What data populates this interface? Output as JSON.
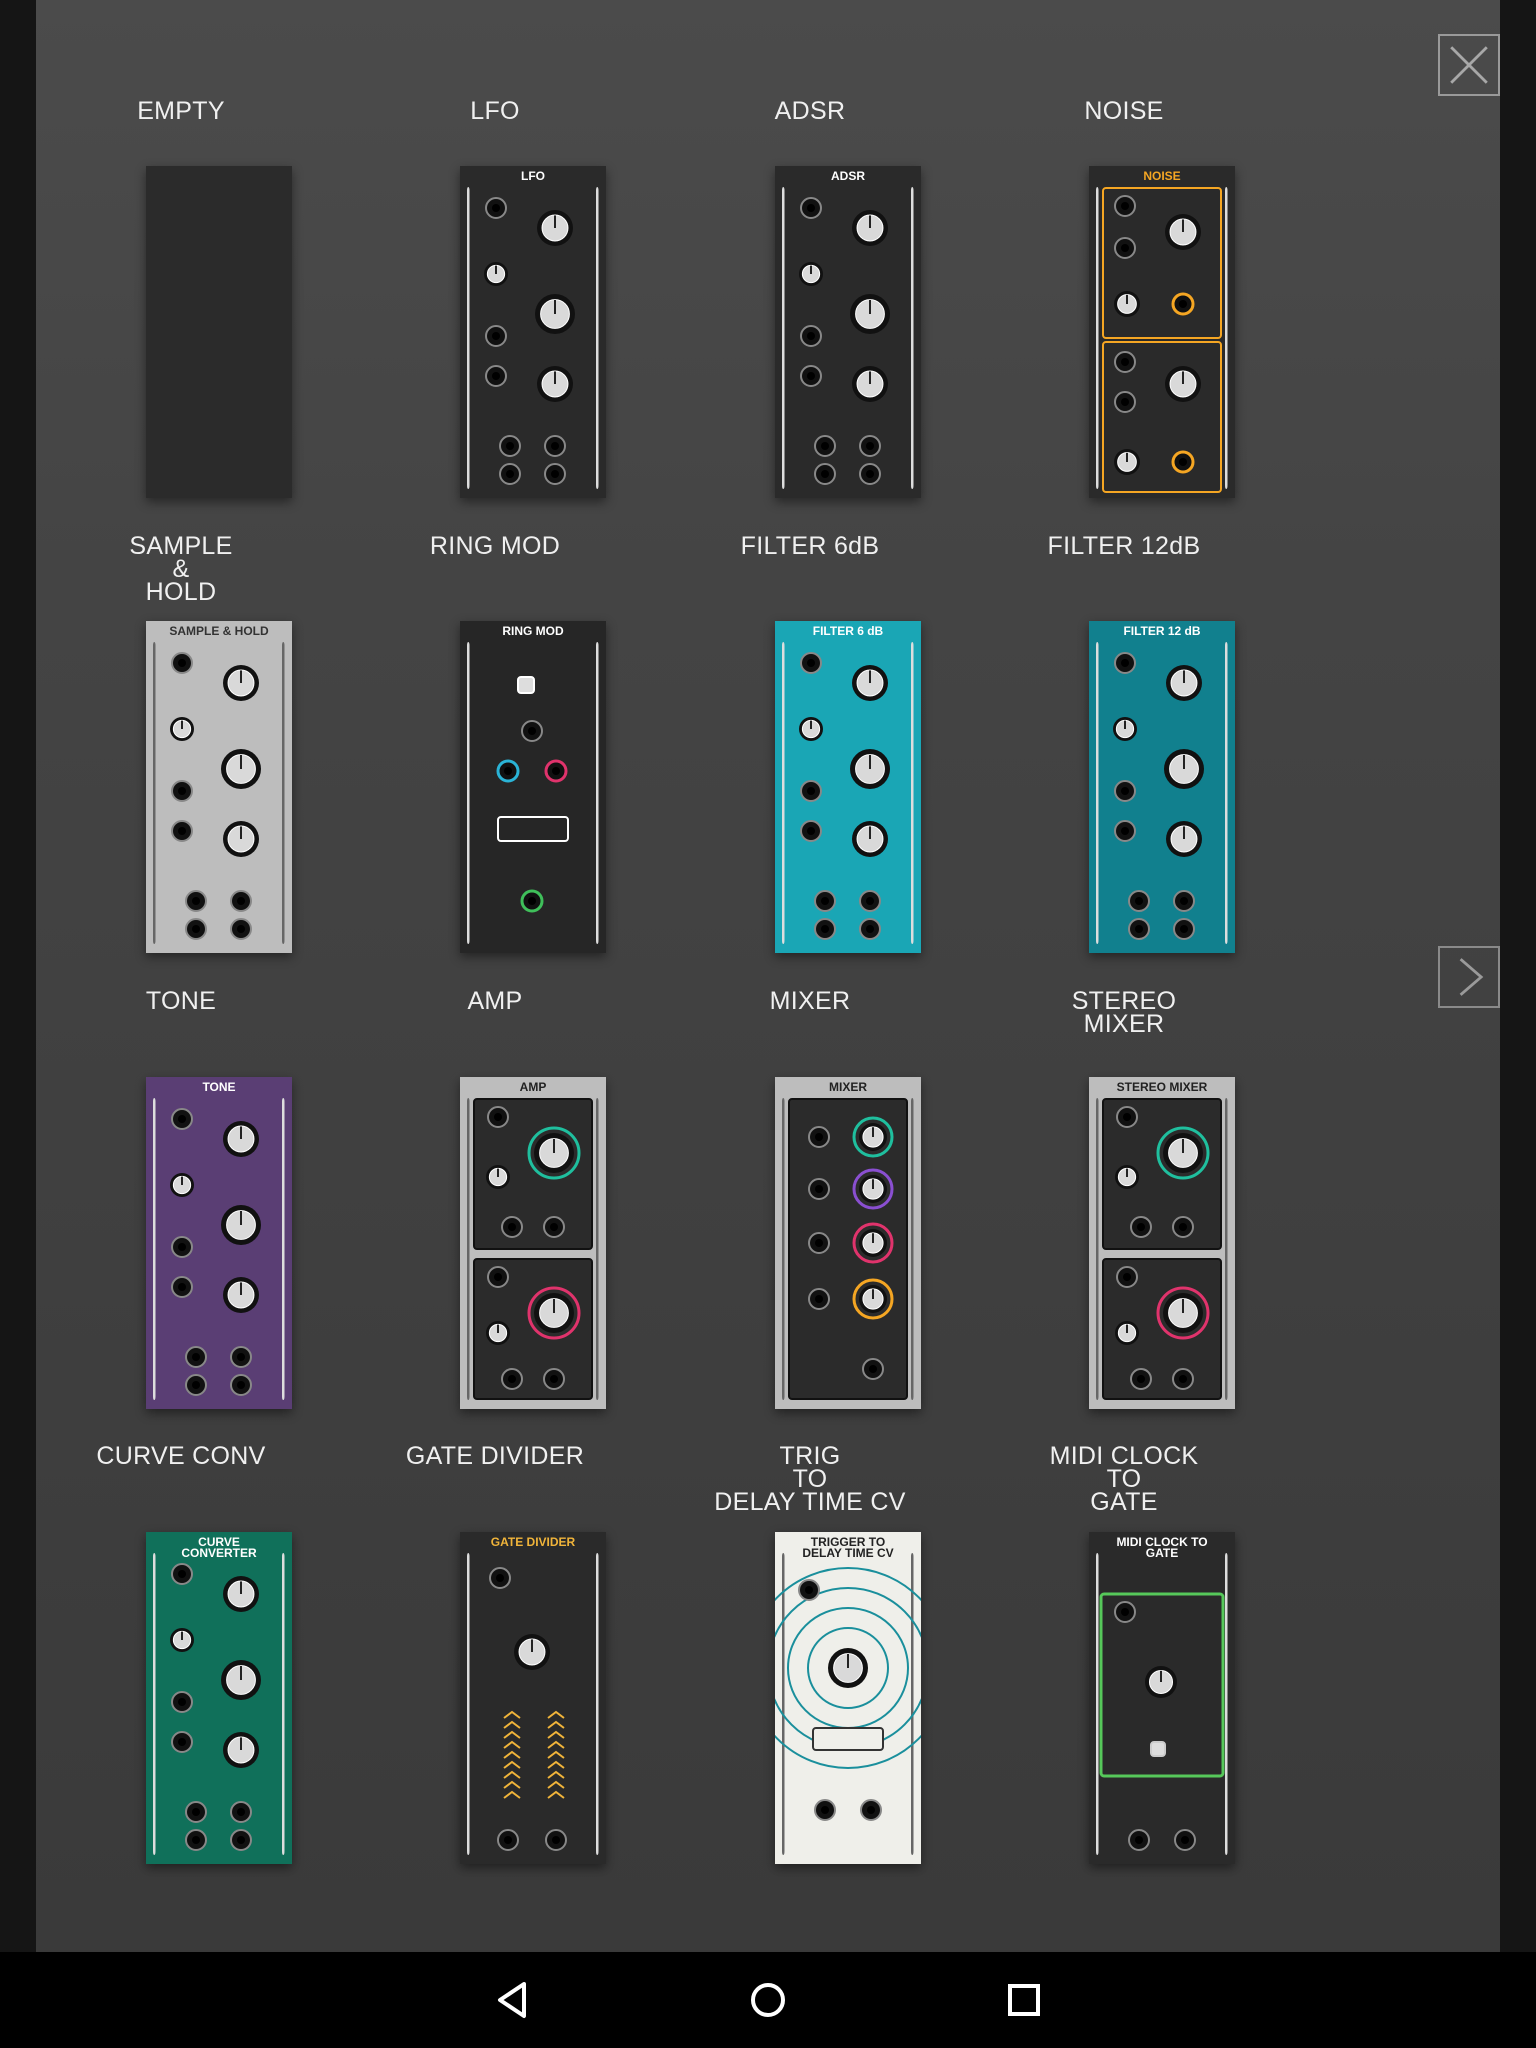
{
  "buttons": {
    "close_icon": "close-x-icon",
    "next_icon": "chevron-right-icon"
  },
  "modules": [
    {
      "id": "empty",
      "title": "EMPTY",
      "label": "",
      "bg": "#2b2b2b",
      "text": "#ffffff",
      "style": "empty"
    },
    {
      "id": "lfo",
      "title": "LFO",
      "label": "LFO",
      "bg": "#2a2a2a",
      "text": "#ffffff",
      "style": "knobs"
    },
    {
      "id": "adsr",
      "title": "ADSR",
      "label": "ADSR",
      "bg": "#2a2a2a",
      "text": "#ffffff",
      "style": "knobs"
    },
    {
      "id": "noise",
      "title": "NOISE",
      "label": "NOISE",
      "bg": "#2a2a2a",
      "text": "#f5a623",
      "style": "noise"
    },
    {
      "id": "sample-hold",
      "title": "SAMPLE\n&\nHOLD",
      "label": "SAMPLE & HOLD",
      "bg": "#bdbdbd",
      "text": "#333333",
      "style": "knobs"
    },
    {
      "id": "ring-mod",
      "title": "RING MOD",
      "label": "RING MOD",
      "bg": "#262626",
      "text": "#ffffff",
      "style": "ring"
    },
    {
      "id": "filter-6db",
      "title": "FILTER 6dB",
      "label": "FILTER 6 dB",
      "bg": "#1aa6b5",
      "text": "#ffffff",
      "style": "knobs"
    },
    {
      "id": "filter-12db",
      "title": "FILTER 12dB",
      "label": "FILTER 12 dB",
      "bg": "#11808e",
      "text": "#ffffff",
      "style": "knobs"
    },
    {
      "id": "tone",
      "title": "TONE",
      "label": "TONE",
      "bg": "#5a3e74",
      "text": "#ffffff",
      "style": "knobs"
    },
    {
      "id": "amp",
      "title": "AMP",
      "label": "AMP",
      "bg": "#bdbdbd",
      "text": "#222222",
      "style": "amp"
    },
    {
      "id": "mixer",
      "title": "MIXER",
      "label": "MIXER",
      "bg": "#bdbdbd",
      "text": "#222222",
      "style": "mixer"
    },
    {
      "id": "stereo-mixer",
      "title": "STEREO\nMIXER",
      "label": "STEREO MIXER",
      "bg": "#bdbdbd",
      "text": "#222222",
      "style": "amp"
    },
    {
      "id": "curve-conv",
      "title": "CURVE CONV",
      "label": "CURVE\nCONVERTER",
      "bg": "#10705a",
      "text": "#ffffff",
      "style": "knobs"
    },
    {
      "id": "gate-divider",
      "title": "GATE DIVIDER",
      "label": "GATE DIVIDER",
      "bg": "#2a2a2a",
      "text": "#f0b43a",
      "style": "gate"
    },
    {
      "id": "trig-delay",
      "title": "TRIG\nTO\nDELAY TIME CV",
      "label": "TRIGGER TO\nDELAY TIME CV",
      "bg": "#efefea",
      "text": "#222222",
      "style": "trig"
    },
    {
      "id": "midi-clock",
      "title": "MIDI CLOCK\nTO\nGATE",
      "label": "MIDI CLOCK TO\nGATE",
      "bg": "#2a2a2a",
      "text": "#ffffff",
      "style": "midi"
    }
  ],
  "navbar": {
    "back_icon": "back-triangle-icon",
    "home_icon": "home-circle-icon",
    "recents_icon": "recents-square-icon"
  }
}
